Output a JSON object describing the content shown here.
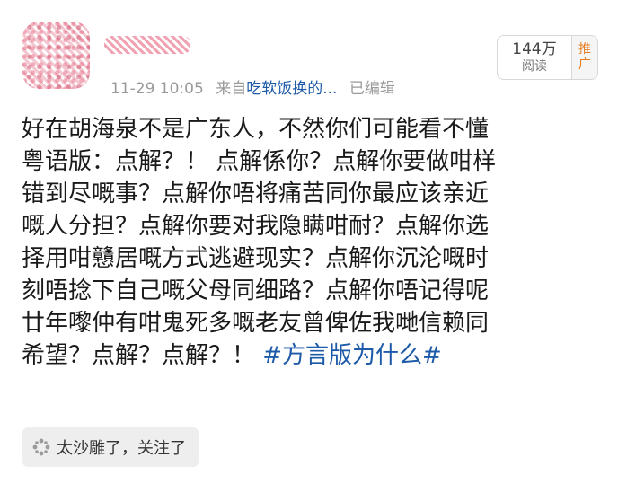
{
  "header": {
    "time": "11-29 10:05",
    "source_prefix": "来自",
    "source_app": "吃软饭换的...",
    "edited": "已编辑"
  },
  "stats": {
    "views": "144万",
    "views_label": "阅读",
    "promote_char_1": "推",
    "promote_char_2": "广"
  },
  "post": {
    "lines": [
      "好在胡海泉不是广东人，不然你们可能看不懂",
      "粤语版：点解？！ 点解係你？点解你要做咁样",
      "错到尽嘅事？点解你唔将痛苦同你最应该亲近",
      "嘅人分担？点解你要对我隐瞒咁耐？点解你选",
      "择用咁戇居嘅方式逃避现实？点解你沉沦嘅时",
      "刻唔捻下自己嘅父母同细路？点解你唔记得呢",
      "廿年嚟仲有咁鬼死多嘅老友曾俾佐我哋信赖同",
      "希望？点解？点解？！ "
    ],
    "hashtag": "#方言版为什么#"
  },
  "reason": {
    "icon": "sparkle-icon",
    "text": "太沙雕了，关注了"
  }
}
